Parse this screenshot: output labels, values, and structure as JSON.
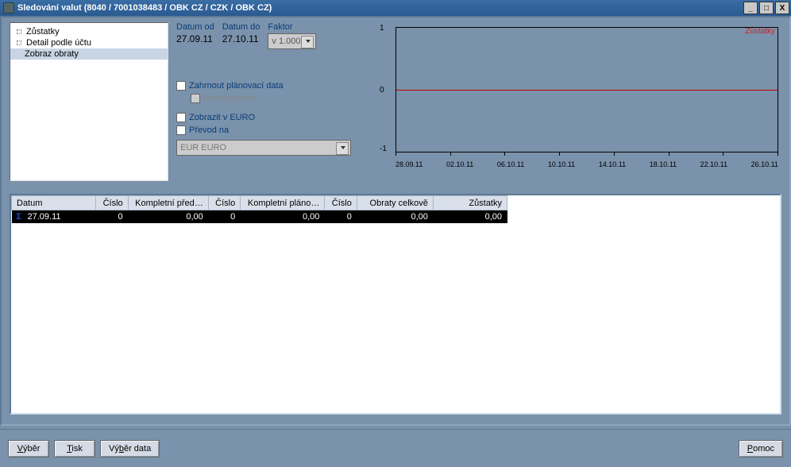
{
  "title": "Sledování valut (8040 / 7001038483 / OBK CZ / CZK / OBK CZ)",
  "tree": {
    "items": [
      {
        "label": "Zůstatky"
      },
      {
        "label": "Detail podle účtu"
      },
      {
        "label": "Zobraz obraty"
      }
    ]
  },
  "form": {
    "datum_od_label": "Datum od",
    "datum_od": "27.09.11",
    "datum_do_label": "Datum do",
    "datum_do": "27.10.11",
    "faktor_label": "Faktor",
    "faktor_value": "v 1.000",
    "cb_zahrnout": "Zahrnout plánovací data",
    "cb_nedef": "nedefingváno",
    "cb_euro": "Zobrazit v EURO",
    "cb_prevod": "Převod na",
    "currency": "EUR EURO"
  },
  "chart": {
    "legend": "Zůstatky"
  },
  "chart_data": {
    "type": "line",
    "series": [
      {
        "name": "Zůstatky",
        "values": [
          0,
          0,
          0,
          0,
          0,
          0,
          0,
          0
        ]
      }
    ],
    "categories": [
      "28.09.11",
      "02.10.11",
      "06.10.11",
      "10.10.11",
      "14.10.11",
      "18.10.11",
      "22.10.11",
      "26.10.11"
    ],
    "ylim": [
      -1,
      1
    ],
    "y_ticks": [
      -1,
      0,
      1
    ],
    "xlabel": "",
    "ylabel": "",
    "title": ""
  },
  "table": {
    "headers": [
      "Datum",
      "Číslo",
      "Kompletní před…",
      "Číslo",
      "Kompletní pláno…",
      "Číslo",
      "Obraty celkově",
      "Zůstatky"
    ],
    "rows": [
      {
        "datum": "27.09.11",
        "c1": "0",
        "kp1": "0,00",
        "c2": "0",
        "kp2": "0,00",
        "c3": "0",
        "obraty": "0,00",
        "zust": "0,00"
      }
    ]
  },
  "buttons": {
    "vyber": "Výběr",
    "tisk": "Tisk",
    "vyber_data": "Výběr data",
    "pomoc": "Pomoc"
  }
}
